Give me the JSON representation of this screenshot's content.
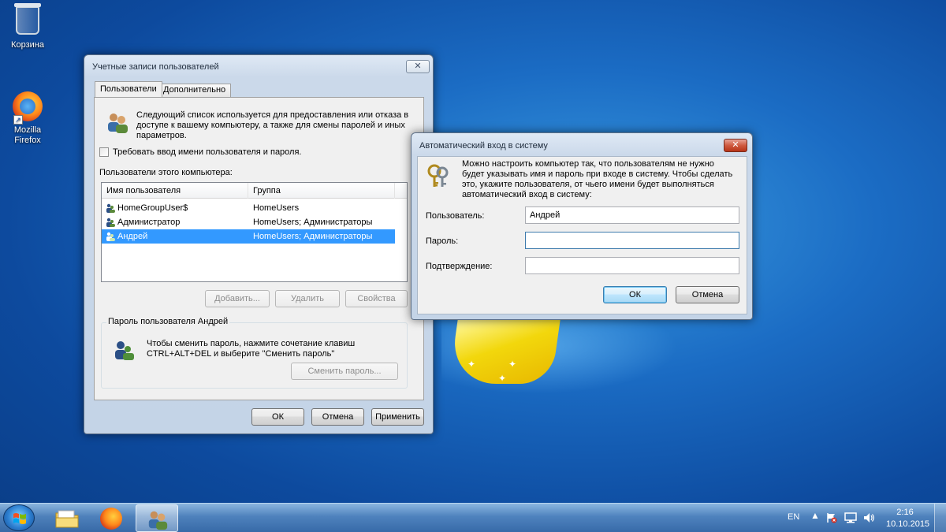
{
  "desktop": {
    "icons": [
      {
        "label": "Корзина"
      },
      {
        "label": "Mozilla\nFirefox"
      }
    ]
  },
  "main_dialog": {
    "title": "Учетные записи пользователей",
    "close_label": "✕",
    "tabs": [
      "Пользователи",
      "Дополнительно"
    ],
    "description": "Следующий список используется для предоставления или отказа в доступе к вашему компьютеру, а также для смены паролей и иных параметров.",
    "require_login_label": "Требовать ввод имени пользователя и пароля.",
    "users_label": "Пользователи этого компьютера:",
    "columns": [
      "Имя пользователя",
      "Группа"
    ],
    "rows": [
      {
        "name": "HomeGroupUser$",
        "group": "HomeUsers",
        "selected": false
      },
      {
        "name": "Администратор",
        "group": "HomeUsers; Администраторы",
        "selected": false
      },
      {
        "name": "Андрей",
        "group": "HomeUsers; Администраторы",
        "selected": true
      }
    ],
    "buttons": {
      "add": "Добавить...",
      "remove": "Удалить",
      "properties": "Свойства"
    },
    "password_group_title": "Пароль пользователя Андрей",
    "password_text": "Чтобы сменить пароль, нажмите сочетание клавиш CTRL+ALT+DEL и выберите \"Сменить пароль\"",
    "change_password_button": "Сменить пароль...",
    "footer": {
      "ok": "ОК",
      "cancel": "Отмена",
      "apply": "Применить"
    }
  },
  "autologon_dialog": {
    "title": "Автоматический вход в систему",
    "close_label": "✕",
    "description": "Можно настроить компьютер так, что пользователям не нужно будет указывать имя и пароль при входе в систему. Чтобы сделать это, укажите пользователя, от чьего имени будет выполняться автоматический вход в систему:",
    "fields": {
      "user_label": "Пользователь:",
      "user_value": "Андрей",
      "password_label": "Пароль:",
      "password_value": "",
      "confirm_label": "Подтверждение:",
      "confirm_value": ""
    },
    "ok": "ОК",
    "cancel": "Отмена"
  },
  "taskbar": {
    "language": "EN",
    "time": "2:16",
    "date": "10.10.2015"
  }
}
